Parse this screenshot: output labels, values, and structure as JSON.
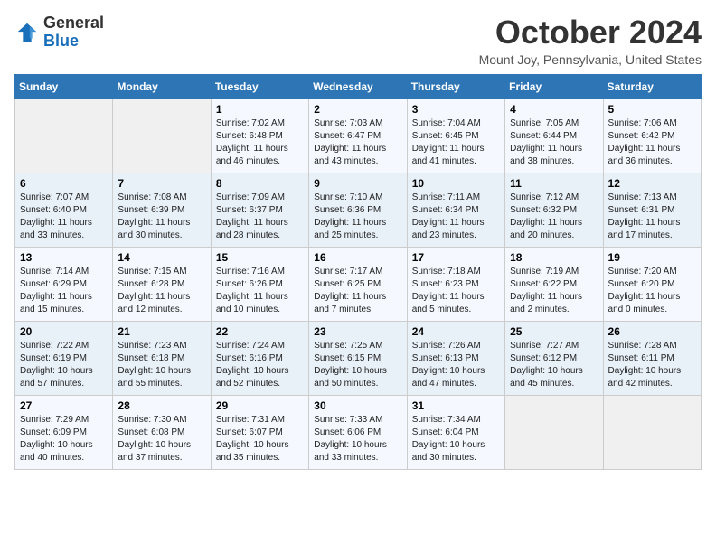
{
  "header": {
    "logo_line1": "General",
    "logo_line2": "Blue",
    "month": "October 2024",
    "location": "Mount Joy, Pennsylvania, United States"
  },
  "weekdays": [
    "Sunday",
    "Monday",
    "Tuesday",
    "Wednesday",
    "Thursday",
    "Friday",
    "Saturday"
  ],
  "weeks": [
    [
      {
        "day": "",
        "info": ""
      },
      {
        "day": "",
        "info": ""
      },
      {
        "day": "1",
        "info": "Sunrise: 7:02 AM\nSunset: 6:48 PM\nDaylight: 11 hours and 46 minutes."
      },
      {
        "day": "2",
        "info": "Sunrise: 7:03 AM\nSunset: 6:47 PM\nDaylight: 11 hours and 43 minutes."
      },
      {
        "day": "3",
        "info": "Sunrise: 7:04 AM\nSunset: 6:45 PM\nDaylight: 11 hours and 41 minutes."
      },
      {
        "day": "4",
        "info": "Sunrise: 7:05 AM\nSunset: 6:44 PM\nDaylight: 11 hours and 38 minutes."
      },
      {
        "day": "5",
        "info": "Sunrise: 7:06 AM\nSunset: 6:42 PM\nDaylight: 11 hours and 36 minutes."
      }
    ],
    [
      {
        "day": "6",
        "info": "Sunrise: 7:07 AM\nSunset: 6:40 PM\nDaylight: 11 hours and 33 minutes."
      },
      {
        "day": "7",
        "info": "Sunrise: 7:08 AM\nSunset: 6:39 PM\nDaylight: 11 hours and 30 minutes."
      },
      {
        "day": "8",
        "info": "Sunrise: 7:09 AM\nSunset: 6:37 PM\nDaylight: 11 hours and 28 minutes."
      },
      {
        "day": "9",
        "info": "Sunrise: 7:10 AM\nSunset: 6:36 PM\nDaylight: 11 hours and 25 minutes."
      },
      {
        "day": "10",
        "info": "Sunrise: 7:11 AM\nSunset: 6:34 PM\nDaylight: 11 hours and 23 minutes."
      },
      {
        "day": "11",
        "info": "Sunrise: 7:12 AM\nSunset: 6:32 PM\nDaylight: 11 hours and 20 minutes."
      },
      {
        "day": "12",
        "info": "Sunrise: 7:13 AM\nSunset: 6:31 PM\nDaylight: 11 hours and 17 minutes."
      }
    ],
    [
      {
        "day": "13",
        "info": "Sunrise: 7:14 AM\nSunset: 6:29 PM\nDaylight: 11 hours and 15 minutes."
      },
      {
        "day": "14",
        "info": "Sunrise: 7:15 AM\nSunset: 6:28 PM\nDaylight: 11 hours and 12 minutes."
      },
      {
        "day": "15",
        "info": "Sunrise: 7:16 AM\nSunset: 6:26 PM\nDaylight: 11 hours and 10 minutes."
      },
      {
        "day": "16",
        "info": "Sunrise: 7:17 AM\nSunset: 6:25 PM\nDaylight: 11 hours and 7 minutes."
      },
      {
        "day": "17",
        "info": "Sunrise: 7:18 AM\nSunset: 6:23 PM\nDaylight: 11 hours and 5 minutes."
      },
      {
        "day": "18",
        "info": "Sunrise: 7:19 AM\nSunset: 6:22 PM\nDaylight: 11 hours and 2 minutes."
      },
      {
        "day": "19",
        "info": "Sunrise: 7:20 AM\nSunset: 6:20 PM\nDaylight: 11 hours and 0 minutes."
      }
    ],
    [
      {
        "day": "20",
        "info": "Sunrise: 7:22 AM\nSunset: 6:19 PM\nDaylight: 10 hours and 57 minutes."
      },
      {
        "day": "21",
        "info": "Sunrise: 7:23 AM\nSunset: 6:18 PM\nDaylight: 10 hours and 55 minutes."
      },
      {
        "day": "22",
        "info": "Sunrise: 7:24 AM\nSunset: 6:16 PM\nDaylight: 10 hours and 52 minutes."
      },
      {
        "day": "23",
        "info": "Sunrise: 7:25 AM\nSunset: 6:15 PM\nDaylight: 10 hours and 50 minutes."
      },
      {
        "day": "24",
        "info": "Sunrise: 7:26 AM\nSunset: 6:13 PM\nDaylight: 10 hours and 47 minutes."
      },
      {
        "day": "25",
        "info": "Sunrise: 7:27 AM\nSunset: 6:12 PM\nDaylight: 10 hours and 45 minutes."
      },
      {
        "day": "26",
        "info": "Sunrise: 7:28 AM\nSunset: 6:11 PM\nDaylight: 10 hours and 42 minutes."
      }
    ],
    [
      {
        "day": "27",
        "info": "Sunrise: 7:29 AM\nSunset: 6:09 PM\nDaylight: 10 hours and 40 minutes."
      },
      {
        "day": "28",
        "info": "Sunrise: 7:30 AM\nSunset: 6:08 PM\nDaylight: 10 hours and 37 minutes."
      },
      {
        "day": "29",
        "info": "Sunrise: 7:31 AM\nSunset: 6:07 PM\nDaylight: 10 hours and 35 minutes."
      },
      {
        "day": "30",
        "info": "Sunrise: 7:33 AM\nSunset: 6:06 PM\nDaylight: 10 hours and 33 minutes."
      },
      {
        "day": "31",
        "info": "Sunrise: 7:34 AM\nSunset: 6:04 PM\nDaylight: 10 hours and 30 minutes."
      },
      {
        "day": "",
        "info": ""
      },
      {
        "day": "",
        "info": ""
      }
    ]
  ]
}
